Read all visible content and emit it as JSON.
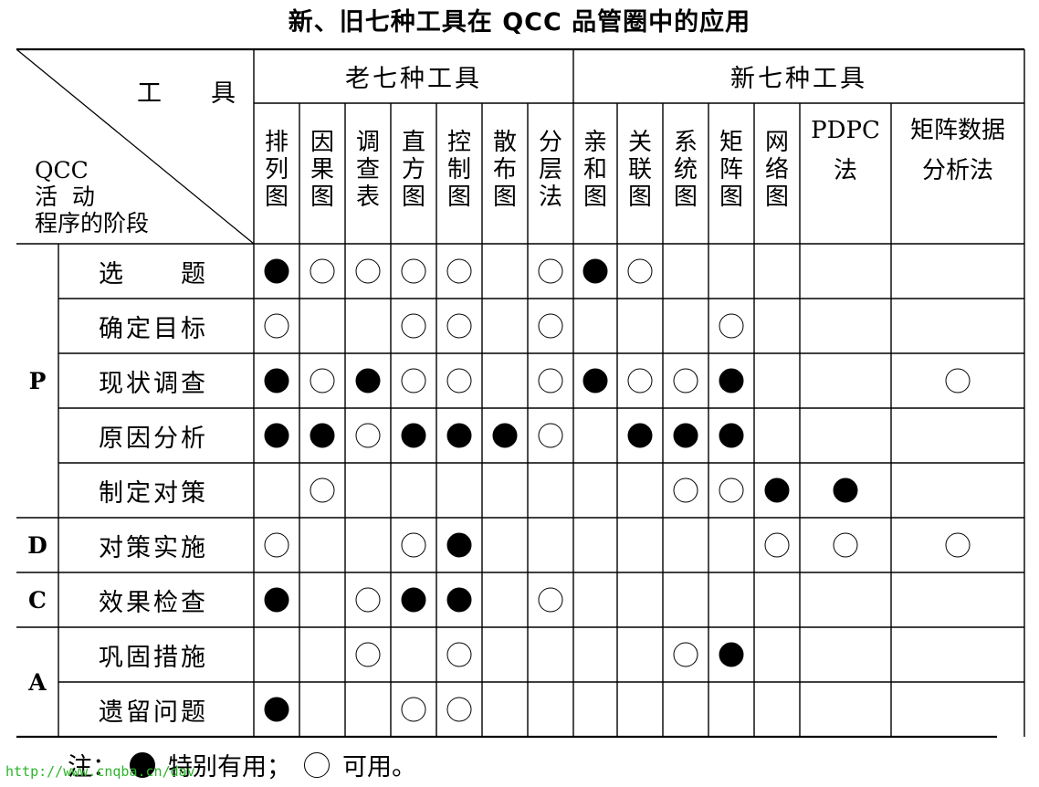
{
  "title": "新、旧七种工具在 QCC 品管圈中的应用",
  "corner": {
    "top_label": "工　　具",
    "bottom_label": [
      "QCC",
      "活  动",
      "程序的阶段"
    ]
  },
  "groups": [
    {
      "label": "老七种工具"
    },
    {
      "label": "新七种工具"
    }
  ],
  "tools": [
    "排列图",
    "因果图",
    "调查表",
    "直方图",
    "控制图",
    "散布图",
    "分层法",
    "亲和图",
    "关联图",
    "系统图",
    "矩阵图",
    "网络图",
    "PDPC法",
    "矩阵数据分析法"
  ],
  "tools_display": [
    "排列图",
    "因果图",
    "调查表",
    "直方图",
    "控制图",
    "散布图",
    "分层法",
    "亲和图",
    "关联图",
    "系统图",
    "矩阵图",
    "网络图",
    "PDPC\n法",
    "矩阵数据\n分析法"
  ],
  "phases": [
    {
      "label": "P"
    },
    {
      "label": "D"
    },
    {
      "label": "C"
    },
    {
      "label": "A"
    }
  ],
  "rows": [
    {
      "stage": "选　　题",
      "marks": [
        "F",
        "O",
        "O",
        "O",
        "O",
        "",
        "O",
        "F",
        "O",
        "",
        "",
        "",
        "",
        ""
      ]
    },
    {
      "stage": "确定目标",
      "marks": [
        "O",
        "",
        "",
        "O",
        "O",
        "",
        "O",
        "",
        "",
        "",
        "O",
        "",
        "",
        ""
      ]
    },
    {
      "stage": "现状调查",
      "marks": [
        "F",
        "O",
        "F",
        "O",
        "O",
        "",
        "O",
        "F",
        "O",
        "O",
        "F",
        "",
        "",
        "O"
      ]
    },
    {
      "stage": "原因分析",
      "marks": [
        "F",
        "F",
        "O",
        "F",
        "F",
        "F",
        "O",
        "",
        "F",
        "F",
        "F",
        "",
        "",
        ""
      ]
    },
    {
      "stage": "制定对策",
      "marks": [
        "",
        "O",
        "",
        "",
        "",
        "",
        "",
        "",
        "",
        "O",
        "O",
        "F",
        "F",
        ""
      ]
    },
    {
      "stage": "对策实施",
      "marks": [
        "O",
        "",
        "",
        "O",
        "F",
        "",
        "",
        "",
        "",
        "",
        "",
        "O",
        "O",
        "O"
      ]
    },
    {
      "stage": "效果检查",
      "marks": [
        "F",
        "",
        "O",
        "F",
        "F",
        "",
        "O",
        "",
        "",
        "",
        "",
        "",
        "",
        ""
      ]
    },
    {
      "stage": "巩固措施",
      "marks": [
        "",
        "",
        "O",
        "",
        "O",
        "",
        "",
        "",
        "",
        "O",
        "F",
        "",
        "",
        ""
      ]
    },
    {
      "stage": "遗留问题",
      "marks": [
        "F",
        "",
        "",
        "O",
        "O",
        "",
        "",
        "",
        "",
        "",
        "",
        "",
        "",
        ""
      ]
    }
  ],
  "legend": {
    "prefix": "注：",
    "filled_label": "特别有用；",
    "open_label": "可用。"
  },
  "watermark": "http://www.cnqba.cn/dav"
}
